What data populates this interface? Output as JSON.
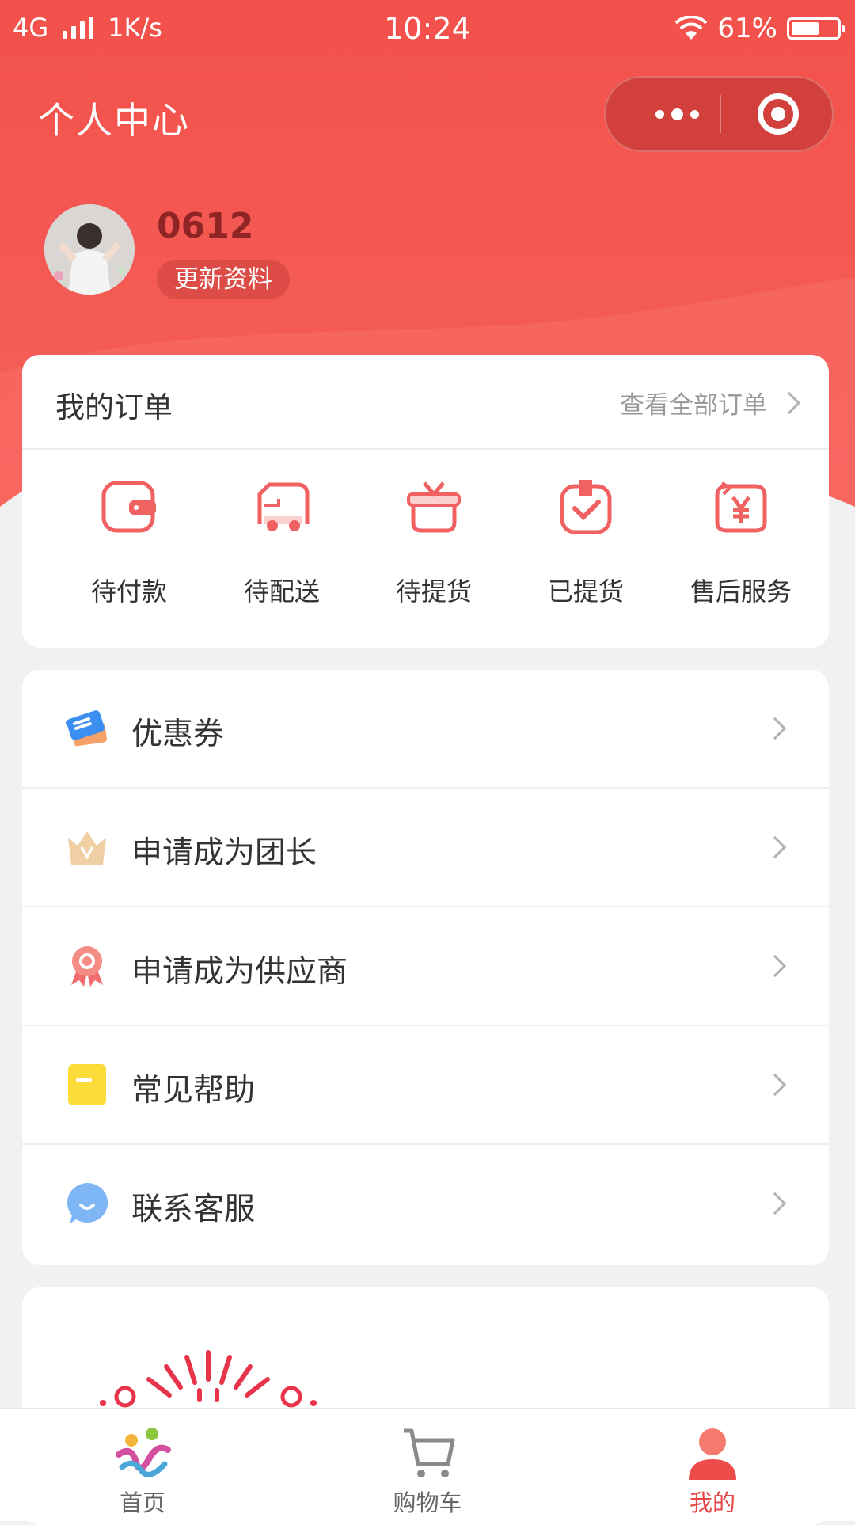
{
  "status_bar": {
    "network": "4G",
    "speed": "1K/s",
    "time": "10:24",
    "battery_percent": "61%",
    "battery_level": 0.61
  },
  "header": {
    "title": "个人中心"
  },
  "profile": {
    "username": "0612",
    "update_label": "更新资料"
  },
  "orders": {
    "title": "我的订单",
    "view_all": "查看全部订单",
    "items": [
      {
        "label": "待付款",
        "icon": "wallet-icon"
      },
      {
        "label": "待配送",
        "icon": "delivery-truck-icon"
      },
      {
        "label": "待提货",
        "icon": "gift-box-icon"
      },
      {
        "label": "已提货",
        "icon": "checked-bag-icon"
      },
      {
        "label": "售后服务",
        "icon": "yen-refresh-icon"
      }
    ]
  },
  "menu": {
    "items": [
      {
        "label": "优惠券",
        "icon": "coupon-icon"
      },
      {
        "label": "申请成为团长",
        "icon": "crown-icon"
      },
      {
        "label": "申请成为供应商",
        "icon": "ribbon-badge-icon"
      },
      {
        "label": "常见帮助",
        "icon": "note-icon"
      },
      {
        "label": "联系客服",
        "icon": "chat-bubble-icon"
      }
    ]
  },
  "tab_bar": {
    "items": [
      {
        "label": "首页",
        "icon": "home-logo-icon"
      },
      {
        "label": "购物车",
        "icon": "cart-icon"
      },
      {
        "label": "我的",
        "icon": "user-icon"
      }
    ],
    "active_index": 2
  },
  "colors": {
    "brand_red": "#f2504b",
    "active_tab": "#e84545"
  }
}
